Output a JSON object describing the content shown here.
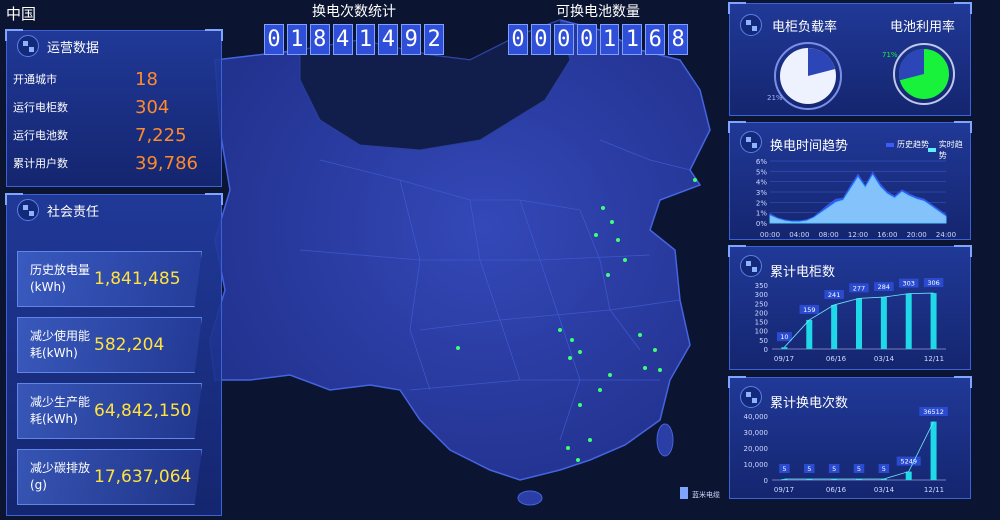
{
  "region": "中国",
  "counters": {
    "swaps": {
      "title": "换电次数统计",
      "digits": [
        "0",
        "1",
        "8",
        "4",
        "1",
        "4",
        "9",
        "2"
      ]
    },
    "batteries": {
      "title": "可换电池数量",
      "digits": [
        "0",
        "0",
        "0",
        "0",
        "1",
        "1",
        "6",
        "8"
      ]
    }
  },
  "operations": {
    "title": "运营数据",
    "rows": [
      {
        "label": "开通城市",
        "value": "18"
      },
      {
        "label": "运行电柜数",
        "value": "304"
      },
      {
        "label": "运行电池数",
        "value": "7,225"
      },
      {
        "label": "累计用户数",
        "value": "39,786"
      }
    ]
  },
  "social": {
    "title": "社会责任",
    "items": [
      {
        "label": "历史放电量(kWh)",
        "value": "1,841,485"
      },
      {
        "label": "减少使用能耗(kWh)",
        "value": "582,204"
      },
      {
        "label": "减少生产能耗(kWh)",
        "value": "64,842,150"
      },
      {
        "label": "减少碳排放(g)",
        "value": "17,637,064"
      }
    ]
  },
  "map": {
    "logo_text": "蓝米电缆",
    "colors": {
      "land": "#2a3ea6",
      "border": "#3f5ed6",
      "dot": "#3dff7a"
    }
  },
  "rates": {
    "cabinet": {
      "title": "电柜负载率",
      "value_label": "21%",
      "value": 21,
      "color": "#8a9dff"
    },
    "battery": {
      "title": "电池利用率",
      "value_label": "71%",
      "value": 71,
      "color": "#19f23a"
    }
  },
  "trend": {
    "title": "换电时间趋势",
    "legend": [
      {
        "name": "历史趋势",
        "color": "#3b5bff"
      },
      {
        "name": "实时趋势",
        "color": "#5ff0ff"
      }
    ]
  },
  "chart_data": [
    {
      "type": "area",
      "title": "换电时间趋势",
      "yticks": [
        "6%",
        "5%",
        "4%",
        "3%",
        "2%",
        "1%",
        "0%"
      ],
      "xticks": [
        "00:00",
        "04:00",
        "08:00",
        "12:00",
        "16:00",
        "20:00",
        "24:00"
      ],
      "ylim": [
        0,
        6
      ],
      "x": [
        0,
        1,
        2,
        3,
        4,
        5,
        6,
        7,
        8,
        9,
        10,
        11,
        12,
        13,
        14,
        15,
        16,
        17,
        18,
        19,
        20,
        21,
        22,
        23,
        24
      ],
      "series": [
        {
          "name": "历史趋势",
          "values": [
            0.9,
            0.5,
            0.3,
            0.2,
            0.2,
            0.3,
            0.6,
            1.2,
            1.8,
            2.3,
            2.4,
            3.6,
            4.7,
            3.6,
            4.9,
            3.8,
            3.0,
            2.6,
            3.2,
            2.8,
            2.5,
            2.3,
            1.8,
            1.3,
            0.8
          ]
        },
        {
          "name": "实时趋势",
          "values": [
            0.7,
            0.4,
            0.2,
            0.1,
            0.1,
            0.2,
            0.5,
            1.0,
            1.5,
            2.0,
            2.2,
            3.3,
            4.4,
            3.4,
            4.6,
            3.5,
            2.8,
            2.4,
            3.0,
            2.6,
            2.3,
            2.1,
            1.6,
            1.1,
            0.6
          ]
        }
      ]
    },
    {
      "type": "bar",
      "title": "累计电柜数",
      "yticks": [
        350,
        300,
        250,
        200,
        150,
        100,
        50,
        0
      ],
      "ylim": [
        0,
        350
      ],
      "xticks": [
        "09/17",
        "06/16",
        "03/14",
        "12/11"
      ],
      "values": [
        10,
        159,
        241,
        277,
        284,
        303,
        306
      ]
    },
    {
      "type": "bar",
      "title": "累计换电次数",
      "yticks": [
        "40,000",
        "30,000",
        "20,000",
        "10,000",
        "0"
      ],
      "ylim": [
        0,
        40000
      ],
      "xticks": [
        "09/17",
        "06/16",
        "03/14",
        "12/11"
      ],
      "values": [
        5,
        5,
        5,
        5,
        5,
        5249,
        36512
      ]
    }
  ]
}
